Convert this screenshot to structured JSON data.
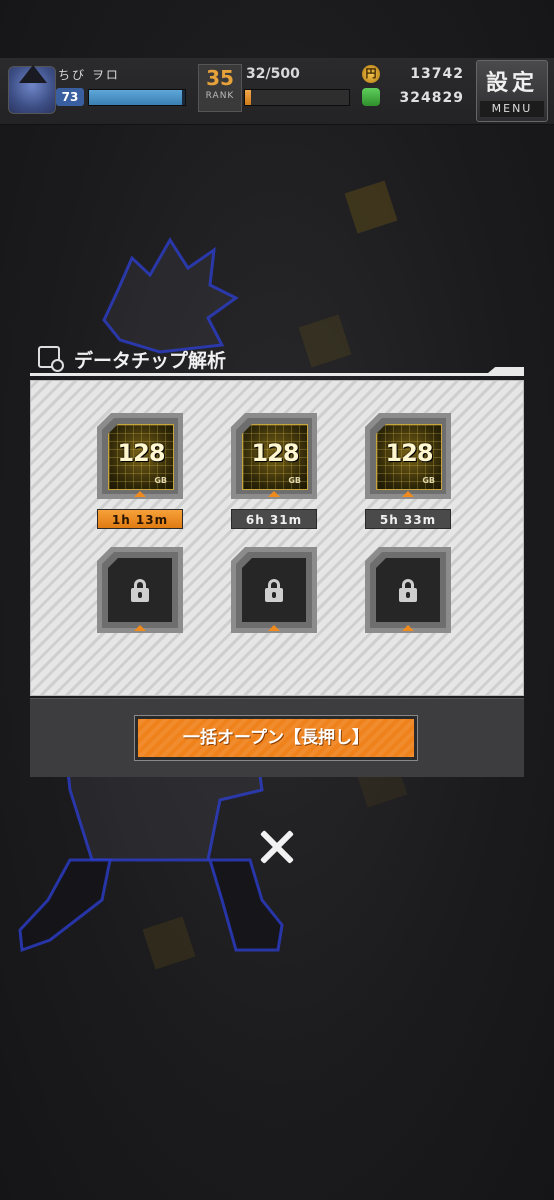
{
  "hud": {
    "player_name": "ちび ヲロ",
    "level": "73",
    "exp_fill_pct": 97,
    "rank_icon_number": "35",
    "rank_label": "RANK",
    "rank_progress": "32/500",
    "rank_fill_pct": 6,
    "coin_symbol": "円",
    "coins": "13742",
    "cash": "324829",
    "settings_label": "設定",
    "menu_label": "MENU"
  },
  "dialog": {
    "title": "データチップ解析",
    "slots": [
      {
        "type": "chip",
        "capacity": "128",
        "unit": "GB",
        "timer": "1h 13m",
        "active": true
      },
      {
        "type": "chip",
        "capacity": "128",
        "unit": "GB",
        "timer": "6h 31m",
        "active": false
      },
      {
        "type": "chip",
        "capacity": "128",
        "unit": "GB",
        "timer": "5h 33m",
        "active": false
      },
      {
        "type": "locked"
      },
      {
        "type": "locked"
      },
      {
        "type": "locked"
      }
    ],
    "open_all_button": "一括オープン【長押し】"
  },
  "colors": {
    "accent": "#f0821c",
    "chip_gold": "#c8a53a",
    "exp_blue": "#4a93c8"
  }
}
